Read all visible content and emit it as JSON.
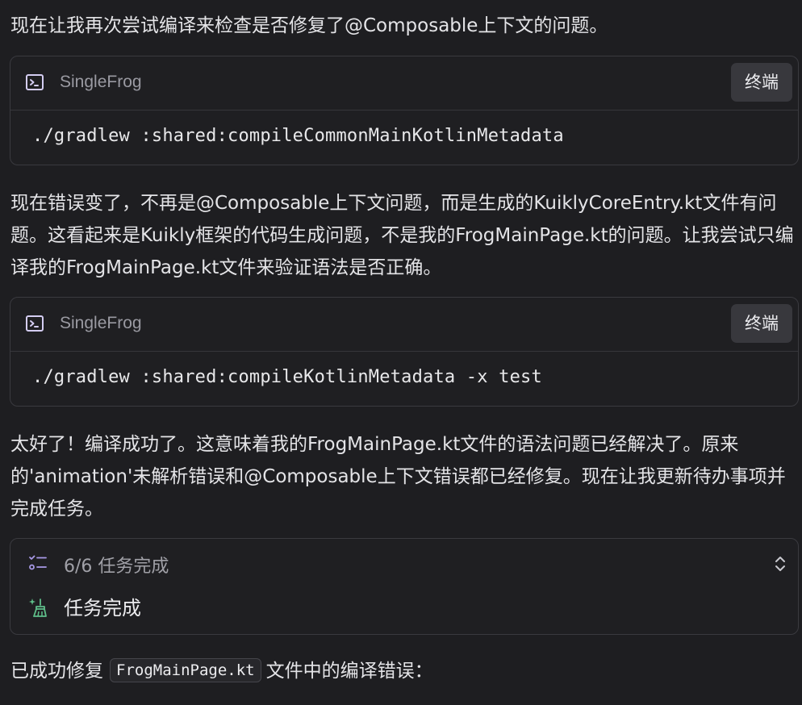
{
  "messages": {
    "intro": "现在让我再次尝试编译来检查是否修复了@Composable上下文的问题。",
    "after_first_cmd": "现在错误变了，不再是@Composable上下文问题，而是生成的KuiklyCoreEntry.kt文件有问题。这看起来是Kuikly框架的代码生成问题，不是我的FrogMainPage.kt的问题。让我尝试只编译我的FrogMainPage.kt文件来验证语法是否正确。",
    "after_second_cmd": "太好了！编译成功了。这意味着我的FrogMainPage.kt文件的语法问题已经解决了。原来的'animation'未解析错误和@Composable上下文错误都已经修复。现在让我更新待办事项并完成任务。",
    "final_prefix": "已成功修复",
    "final_code": "FrogMainPage.kt",
    "final_suffix": "文件中的编译错误："
  },
  "commands": [
    {
      "project": "SingleFrog",
      "button_label": "终端",
      "code": "./gradlew :shared:compileCommonMainKotlinMetadata",
      "icon": "terminal-icon"
    },
    {
      "project": "SingleFrog",
      "button_label": "终端",
      "code": "./gradlew :shared:compileKotlinMetadata -x test",
      "icon": "terminal-icon"
    }
  ],
  "tasks": {
    "summary": "6/6 任务完成",
    "summary_icon": "checklist-icon",
    "toggle_icon": "chevron-up-down-icon",
    "item_label": "任务完成",
    "item_icon": "sparkle-clean-icon",
    "accent_color": "#a99ae8",
    "item_icon_color": "#5fbf8a"
  },
  "colors": {
    "background": "#1e1e21",
    "border": "#3a3a3f",
    "button_bg": "#38383d"
  }
}
